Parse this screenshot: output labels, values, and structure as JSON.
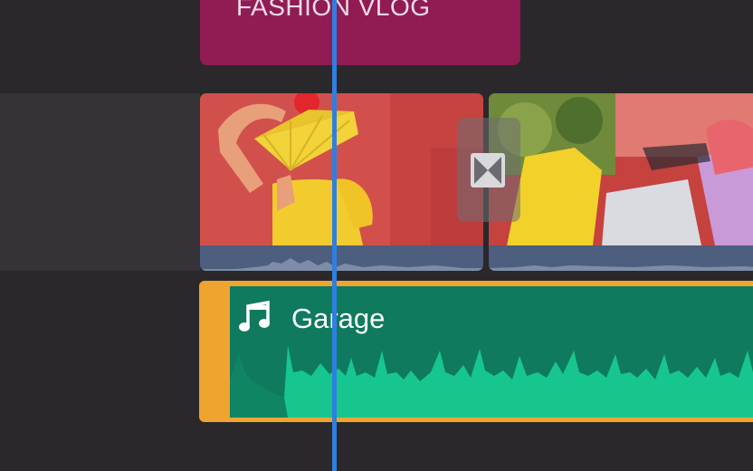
{
  "timeline": {
    "title_clip": {
      "label": "FASHION VLOG",
      "color": "#901c53"
    },
    "video_clips": [
      {
        "name": "clip-woman-with-fan",
        "dominant_color": "#d2504c"
      },
      {
        "name": "clip-clothes-pile",
        "dominant_color": "#c5423f"
      }
    ],
    "transition": {
      "icon": "bowtie-transition-icon"
    },
    "audio_clip": {
      "label": "Garage",
      "icon": "music-note-icon",
      "selection_color": "#f0a430",
      "fill_color": "#0f7a5e",
      "wave_color": "#16c68e"
    },
    "playhead": {
      "color": "#2f7fe0"
    }
  }
}
